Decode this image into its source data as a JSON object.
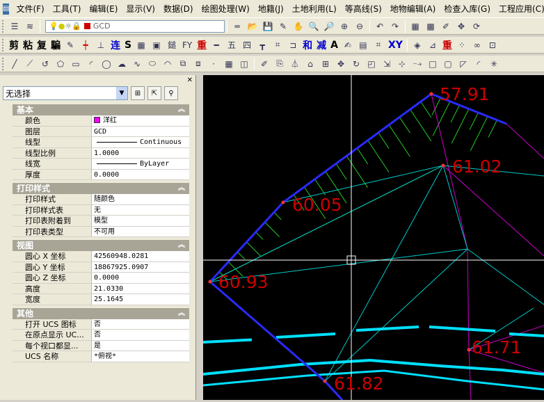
{
  "menubar": {
    "items": [
      "文件(F)",
      "工具(T)",
      "编辑(E)",
      "显示(V)",
      "数据(D)",
      "绘图处理(W)",
      "地籍(J)",
      "土地利用(L)",
      "等高线(S)",
      "地物编辑(A)",
      "检查入库(G)",
      "工程应用(C)"
    ]
  },
  "toolbar1": {
    "layer_name": "GCD"
  },
  "toolbar2": {
    "labels": [
      "剪",
      "粘",
      "复",
      "騙",
      "连",
      "S",
      "重",
      "和",
      "减",
      "A",
      "XY"
    ]
  },
  "panel": {
    "selection": "无选择",
    "sections": [
      {
        "title": "基本",
        "rows": [
          {
            "k": "颜色",
            "v": "洋红",
            "type": "color"
          },
          {
            "k": "图层",
            "v": "GCD"
          },
          {
            "k": "线型",
            "v": "Continuous",
            "type": "line"
          },
          {
            "k": "线型比例",
            "v": "1.0000"
          },
          {
            "k": "线宽",
            "v": "ByLayer",
            "type": "line"
          },
          {
            "k": "厚度",
            "v": "0.0000"
          }
        ]
      },
      {
        "title": "打印样式",
        "rows": [
          {
            "k": "打印样式",
            "v": "随颜色"
          },
          {
            "k": "打印样式表",
            "v": "无"
          },
          {
            "k": "打印表附着到",
            "v": "模型"
          },
          {
            "k": "打印表类型",
            "v": "不可用"
          }
        ]
      },
      {
        "title": "视图",
        "rows": [
          {
            "k": "圆心 X 坐标",
            "v": "42560948.0281"
          },
          {
            "k": "圆心 Y 坐标",
            "v": "18867925.0907"
          },
          {
            "k": "圆心 Z 坐标",
            "v": "0.0000"
          },
          {
            "k": "高度",
            "v": "21.0330"
          },
          {
            "k": "宽度",
            "v": "25.1645"
          }
        ]
      },
      {
        "title": "其他",
        "rows": [
          {
            "k": "打开 UCS 图标",
            "v": "否"
          },
          {
            "k": "在原点显示 UC...",
            "v": "否"
          },
          {
            "k": "每个视口都显...",
            "v": "是"
          },
          {
            "k": "UCS 名称",
            "v": "*俯视*"
          }
        ]
      }
    ]
  },
  "drawing": {
    "elevations": [
      "57.91",
      "61.02",
      "60.05",
      "60.93",
      "61.71",
      "61.82"
    ],
    "colors": {
      "boundary": "#2a2aff",
      "hatch": "#22cc22",
      "triangles": "#00cccc",
      "magenta": "#cc00cc",
      "label": "#cc0000",
      "road": "#00e0ff"
    }
  }
}
